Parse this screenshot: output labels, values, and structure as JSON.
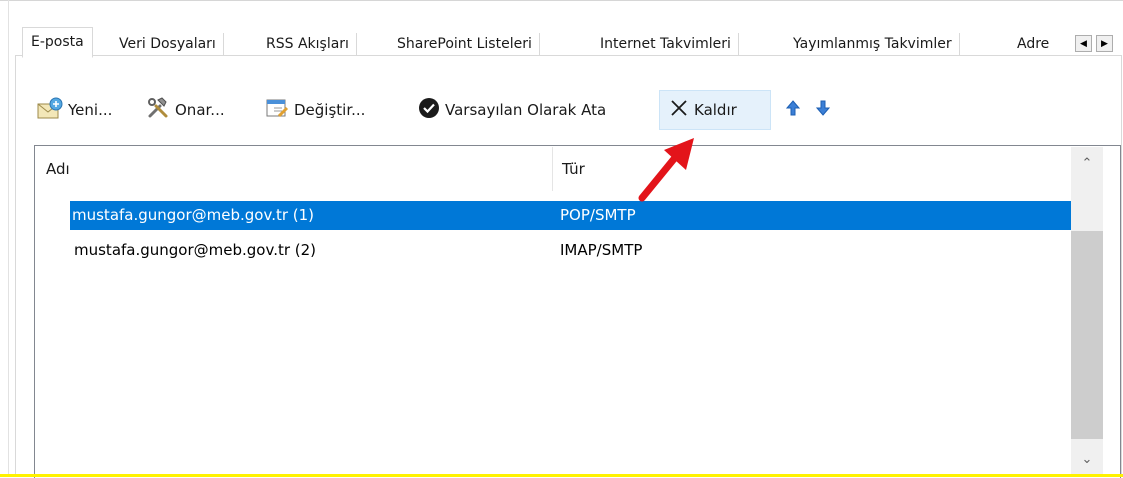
{
  "tabs": [
    {
      "label": "E-posta",
      "active": true
    },
    {
      "label": "Veri Dosyaları"
    },
    {
      "label": "RSS Akışları"
    },
    {
      "label": "SharePoint Listeleri"
    },
    {
      "label": "Internet Takvimleri"
    },
    {
      "label": "Yayımlanmış Takvimler"
    },
    {
      "label": "Adre"
    }
  ],
  "tab_scroll": {
    "left": "◀",
    "right": "▶"
  },
  "toolbar": {
    "new_label": "Yeni...",
    "repair_label": "Onar...",
    "change_label": "Değiştir...",
    "default_label": "Varsayılan Olarak Ata",
    "remove_label": "Kaldır",
    "up_icon": "arrow-up-icon",
    "down_icon": "arrow-down-icon"
  },
  "list": {
    "columns": [
      "Adı",
      "Tür"
    ],
    "rows": [
      {
        "name": "mustafa.gungor@meb.gov.tr (1)",
        "type": "POP/SMTP",
        "selected": true
      },
      {
        "name": "mustafa.gungor@meb.gov.tr (2)",
        "type": "IMAP/SMTP",
        "selected": false
      }
    ]
  },
  "scrollbar": {
    "up": "⌃",
    "down": "⌄"
  },
  "colors": {
    "selection": "#0078d7",
    "annotation_arrow": "#e3141a",
    "highlight_border": "#fff200"
  }
}
